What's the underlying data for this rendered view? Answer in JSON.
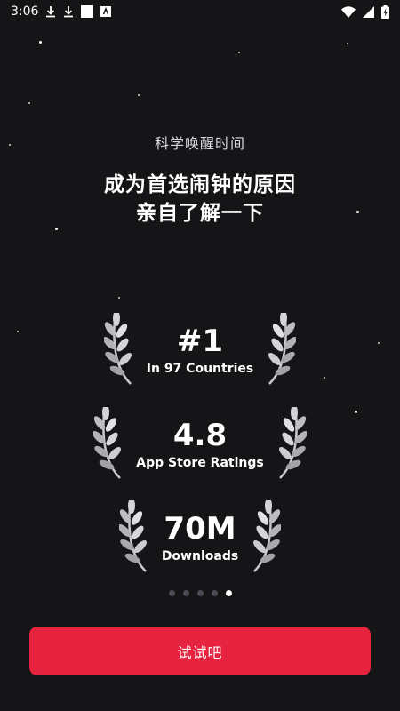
{
  "status_bar": {
    "time": "3:06"
  },
  "intro": {
    "subtitle": "科学唤醒时间",
    "headline_line1": "成为首选闹钟的原因",
    "headline_line2": "亲自了解一下"
  },
  "awards": [
    {
      "value": "#1",
      "label": "In 97 Countries"
    },
    {
      "value": "4.8",
      "label": "App Store Ratings"
    },
    {
      "value": "70M",
      "label": "Downloads"
    }
  ],
  "pagination": {
    "total": 5,
    "active_index": 4
  },
  "cta": {
    "label": "试试吧"
  },
  "colors": {
    "background": "#151518",
    "accent": "#e7243f"
  }
}
